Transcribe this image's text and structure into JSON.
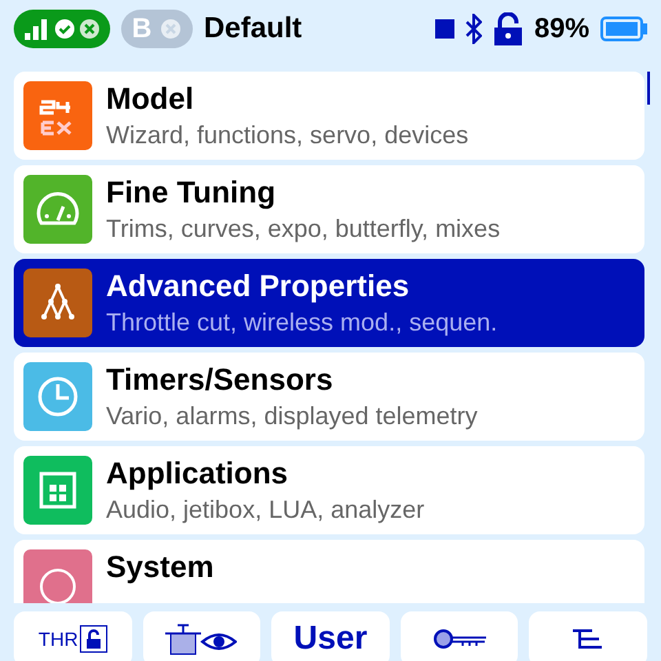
{
  "status_bar": {
    "receiver_label": "B",
    "model_name": "Default",
    "battery_percent": "89%"
  },
  "menu": [
    {
      "title": "Model",
      "subtitle": "Wizard, functions, servo, devices",
      "color": "#f96410",
      "selected": false
    },
    {
      "title": "Fine Tuning",
      "subtitle": "Trims, curves, expo, butterfly, mixes",
      "color": "#52b42a",
      "selected": false
    },
    {
      "title": "Advanced Properties",
      "subtitle": "Throttle cut, wireless mod., sequen.",
      "color": "#b85a14",
      "selected": true
    },
    {
      "title": "Timers/Sensors",
      "subtitle": "Vario, alarms, displayed telemetry",
      "color": "#4bbbe6",
      "selected": false
    },
    {
      "title": "Applications",
      "subtitle": "Audio, jetibox, LUA, analyzer",
      "color": "#0fbd5e",
      "selected": false
    },
    {
      "title": "System",
      "color": "#e0708c",
      "selected": false
    }
  ],
  "bottom_bar": [
    {
      "kind": "thr",
      "label": "THR"
    },
    {
      "kind": "trim"
    },
    {
      "kind": "text",
      "label": "User"
    },
    {
      "kind": "key"
    },
    {
      "kind": "tree"
    }
  ]
}
